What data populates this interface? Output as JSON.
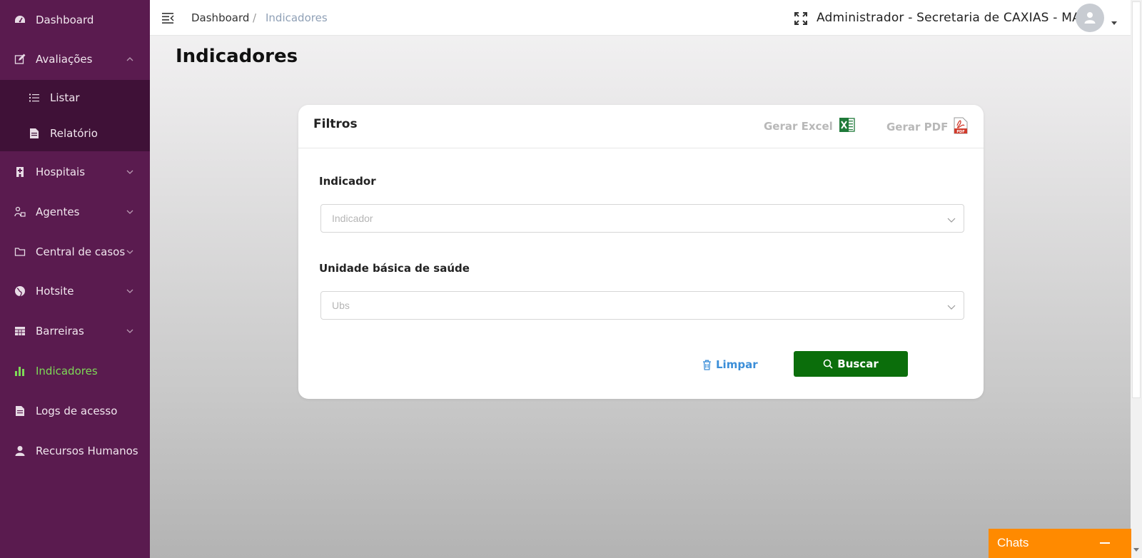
{
  "sidebar": {
    "items": [
      {
        "label": "Dashboard",
        "icon": "dashboard-icon"
      },
      {
        "label": "Avaliações",
        "icon": "edit-icon",
        "expanded": true
      },
      {
        "label": "Hospitais",
        "icon": "hospital-icon"
      },
      {
        "label": "Agentes",
        "icon": "agents-icon"
      },
      {
        "label": "Central de casos",
        "icon": "folder-icon"
      },
      {
        "label": "Hotsite",
        "icon": "globe-icon"
      },
      {
        "label": "Barreiras",
        "icon": "table-icon"
      },
      {
        "label": "Indicadores",
        "icon": "bar-chart-icon",
        "active": true
      },
      {
        "label": "Logs de acesso",
        "icon": "document-icon"
      },
      {
        "label": "Recursos Humanos",
        "icon": "person-icon"
      }
    ],
    "subitems": [
      {
        "label": "Listar",
        "icon": "list-icon"
      },
      {
        "label": "Relatório",
        "icon": "report-icon"
      }
    ],
    "active_color": "#7ed957",
    "background": "#5a1b4f"
  },
  "header": {
    "breadcrumb": {
      "home": "Dashboard",
      "separator": "/",
      "current": "Indicadores"
    },
    "user": "Administrador - Secretaria de CAXIAS - MA"
  },
  "page": {
    "title": "Indicadores"
  },
  "card": {
    "title": "Filtros",
    "export_excel": "Gerar Excel",
    "export_pdf": "Gerar PDF",
    "fields": [
      {
        "label": "Indicador",
        "placeholder": "Indicador"
      },
      {
        "label": "Unidade básica de saúde",
        "placeholder": "Ubs"
      }
    ],
    "clear_label": "Limpar",
    "search_label": "Buscar",
    "search_color": "#0b6e0b"
  },
  "chats": {
    "label": "Chats",
    "color": "#ff8a00"
  }
}
